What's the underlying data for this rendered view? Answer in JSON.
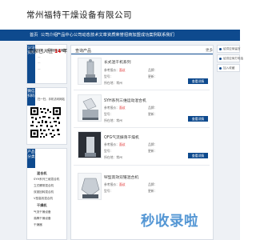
{
  "header": {
    "company_name": "常州福特干燥设备有限公司"
  },
  "nav": {
    "items": [
      "首页",
      "公司介绍",
      "产品中心",
      "公司动态",
      "技术文章",
      "资质荣誉",
      "招商加盟",
      "成功案例",
      "联系我们"
    ],
    "item_positions_note": ""
  },
  "sidebar": {
    "badge_label": "认证资料",
    "verified_line": "认证：常州福特干燥设备有限公司",
    "join_years_prefix": "商家已入驻",
    "join_years_value": "14",
    "join_years_suffix": "年",
    "qr_tag": "微信扫码",
    "qr_hint": "扫一扫，手机访问网站",
    "category_tag": "产品分类",
    "categories": [
      "混合机",
      "SYH系列三维混合机",
      "立式螺带混合机",
      "双锥回转混合机",
      "V型高效混合机",
      "干燥机",
      "气流干燥设备",
      "沸腾干燥设备",
      "干燥器"
    ]
  },
  "main": {
    "section_title": "查询产品",
    "more_label": "更多",
    "products": [
      {
        "name": "长式混干机系列",
        "price_label": "参考报价：",
        "price_value": "面议",
        "type_label": "型号：",
        "brand_label": "品牌：",
        "update_label": "更新：",
        "area_label": "所在地：",
        "area_value": "常州",
        "button": "查看详情"
      },
      {
        "name": "SYH系列三维运动混合机",
        "price_label": "参考报价：",
        "price_value": "面议",
        "type_label": "型号：",
        "brand_label": "品牌：",
        "update_label": "更新：",
        "area_label": "所在地：",
        "area_value": "常州",
        "button": "查看详情"
      },
      {
        "name": "QFG气流振荡干燥机",
        "price_label": "参考报价：",
        "price_value": "面议",
        "type_label": "型号：",
        "brand_label": "品牌：",
        "update_label": "更新：",
        "area_label": "所在地：",
        "area_value": "常州",
        "button": "查看详情"
      },
      {
        "name": "W型高效双锥混合机",
        "price_label": "参考报价：",
        "price_value": "面议",
        "type_label": "型号：",
        "brand_label": "品牌：",
        "update_label": "更新：",
        "area_label": "所在地：",
        "area_value": "常州",
        "button": "查看详情"
      }
    ]
  },
  "right": {
    "items": [
      "给供应商留言",
      "给供应商打电话",
      "加入收藏"
    ]
  },
  "watermark": {
    "text": "秒收录啦"
  },
  "colors": {
    "nav": "#0e4a8e",
    "accent_red": "#d22",
    "page_bg": "#eef1f5"
  }
}
